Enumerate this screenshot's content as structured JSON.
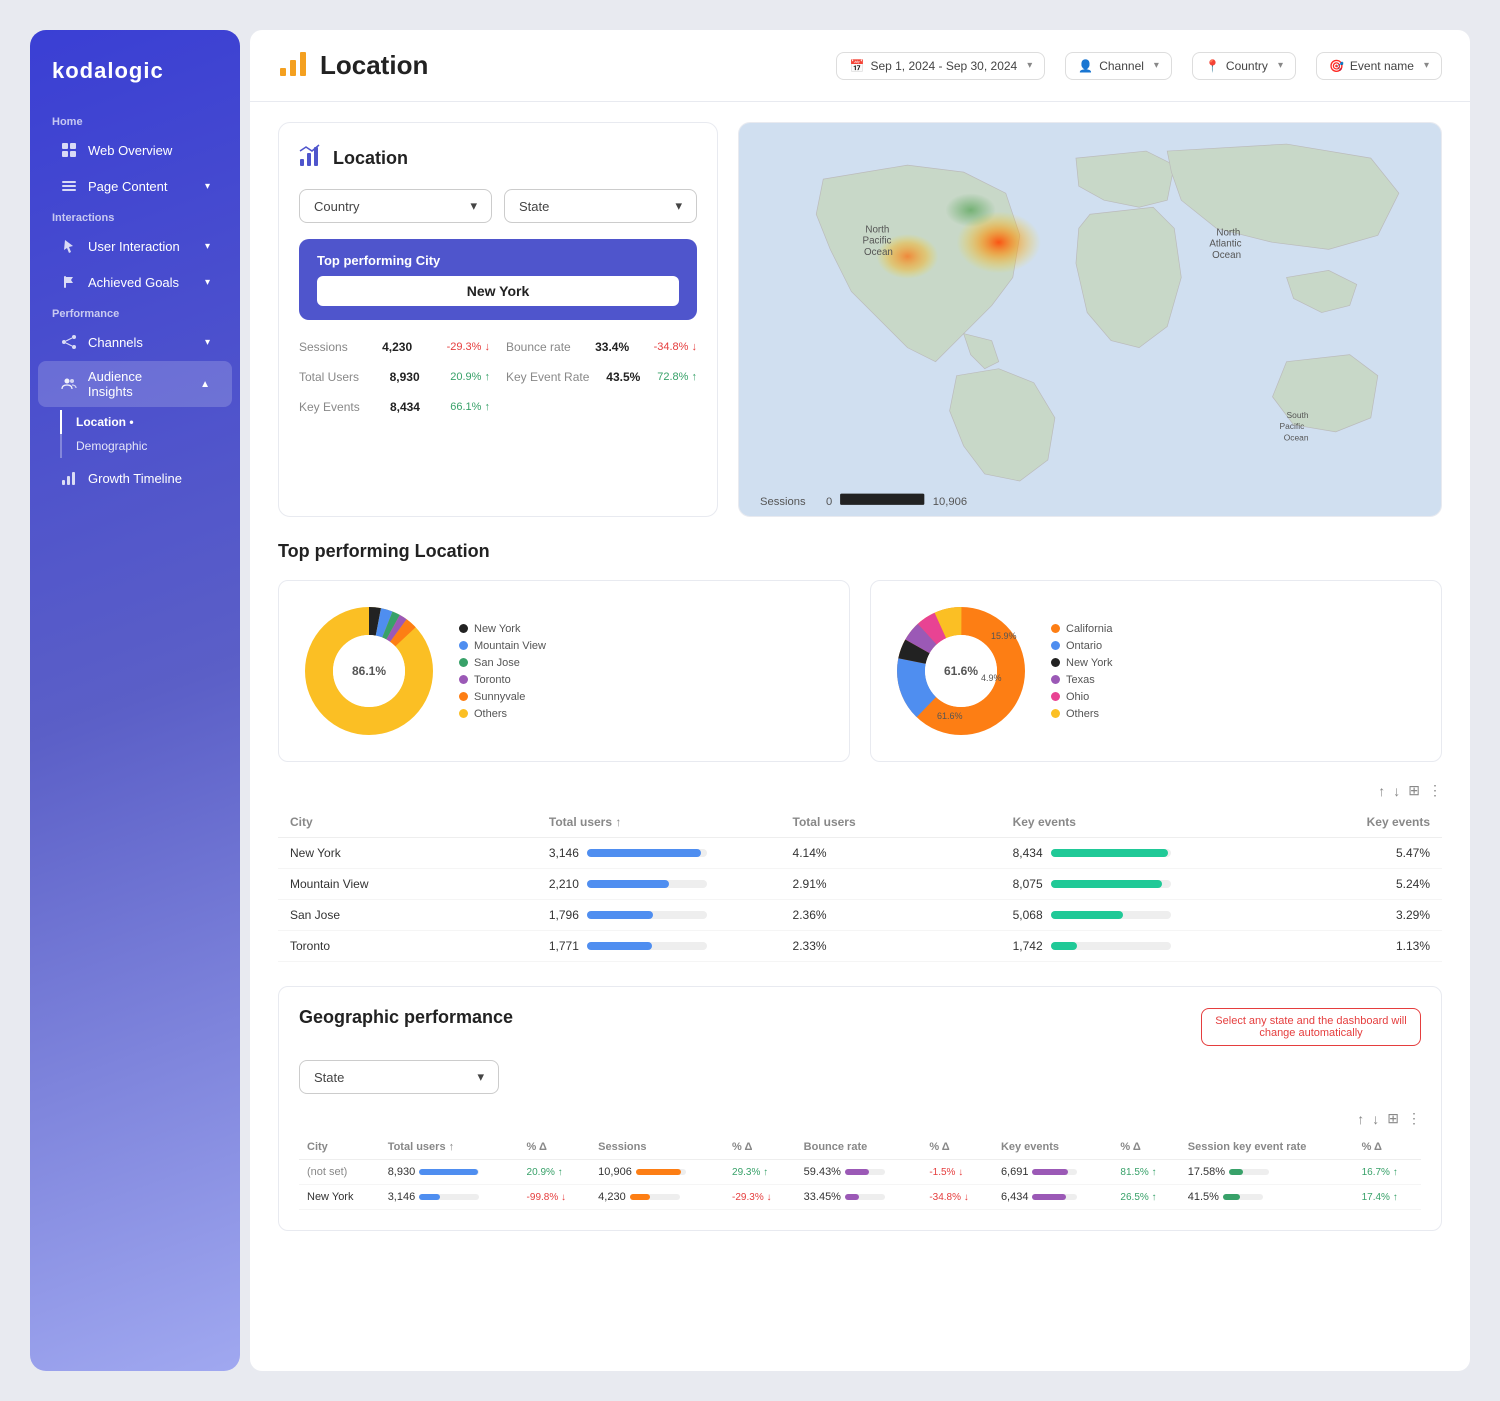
{
  "app": {
    "name": "kodalogic"
  },
  "sidebar": {
    "sections": [
      {
        "label": "Home",
        "items": [
          {
            "id": "web-overview",
            "label": "Web Overview",
            "icon": "grid",
            "active": false
          }
        ]
      },
      {
        "label": "Page Content",
        "items": [
          {
            "id": "page-content",
            "label": "Page Content",
            "icon": "list",
            "active": false,
            "hasArrow": true
          }
        ]
      },
      {
        "label": "Interactions",
        "items": [
          {
            "id": "user-interaction",
            "label": "User Interaction",
            "icon": "cursor",
            "active": false,
            "hasArrow": true
          },
          {
            "id": "achieved-goals",
            "label": "Achieved Goals",
            "icon": "flag",
            "active": false,
            "hasArrow": true
          }
        ]
      },
      {
        "label": "Performance",
        "items": [
          {
            "id": "channels",
            "label": "Channels",
            "icon": "share",
            "active": false,
            "hasArrow": true
          },
          {
            "id": "audience-insights",
            "label": "Audience Insights",
            "icon": "people",
            "active": true,
            "hasArrow": true,
            "children": [
              {
                "id": "location",
                "label": "Location •",
                "active": true
              },
              {
                "id": "demographic",
                "label": "Demographic",
                "active": false
              }
            ]
          },
          {
            "id": "growth-timeline",
            "label": "Growth Timeline",
            "icon": "chart",
            "active": false
          }
        ]
      }
    ]
  },
  "header": {
    "title": "Location",
    "filters": [
      {
        "id": "date-range",
        "icon": "📅",
        "label": "Sep 1, 2024 - Sep 30, 2024"
      },
      {
        "id": "channel",
        "icon": "👤",
        "label": "Channel"
      },
      {
        "id": "country",
        "icon": "📍",
        "label": "Country"
      },
      {
        "id": "event-name",
        "icon": "🎯",
        "label": "Event name"
      }
    ]
  },
  "location_card": {
    "title": "Location",
    "filters": [
      "Country",
      "State"
    ],
    "top_city_label": "Top performing City",
    "top_city": "New York",
    "metrics": [
      {
        "label": "Sessions",
        "value": "4,230",
        "change": "-29.3%",
        "dir": "neg"
      },
      {
        "label": "Bounce rate",
        "value": "33.4%",
        "change": "-34.8%",
        "dir": "neg"
      },
      {
        "label": "Total Users",
        "value": "8,930",
        "change": "20.9%",
        "dir": "pos"
      },
      {
        "label": "Key Event Rate",
        "value": "43.5%",
        "change": "72.8%",
        "dir": "pos"
      },
      {
        "label": "Key Events",
        "value": "8,434",
        "change": "66.1%",
        "dir": "pos"
      }
    ]
  },
  "top_performing": {
    "title": "Top performing Location",
    "city_chart": {
      "label": "86.1%",
      "segments": [
        {
          "label": "New York",
          "color": "#222",
          "pct": 3
        },
        {
          "label": "Mountain View",
          "color": "#4f8ef0",
          "pct": 3
        },
        {
          "label": "San Jose",
          "color": "#38a169",
          "pct": 2
        },
        {
          "label": "Toronto",
          "color": "#9b59b6",
          "pct": 2
        },
        {
          "label": "Sunnyvale",
          "color": "#fd7e14",
          "pct": 3
        },
        {
          "label": "Others",
          "color": "#fbbf24",
          "pct": 87
        }
      ]
    },
    "state_chart": {
      "label": "61.6%",
      "segments": [
        {
          "label": "California",
          "color": "#fd7e14",
          "pct": 62
        },
        {
          "label": "Ontario",
          "color": "#4f8ef0",
          "pct": 16
        },
        {
          "label": "New York",
          "color": "#222",
          "pct": 5
        },
        {
          "label": "Texas",
          "color": "#9b59b6",
          "pct": 5
        },
        {
          "label": "Ohio",
          "color": "#e84393",
          "pct": 5
        },
        {
          "label": "Others",
          "color": "#fbbf24",
          "pct": 7
        }
      ]
    },
    "table": {
      "headers": [
        "City",
        "Total users ↑",
        "Total users",
        "Key events",
        "Key events"
      ],
      "rows": [
        {
          "city": "New York",
          "total_users_val": "3,146",
          "total_users_bar": 95,
          "total_users_pct": "4.14%",
          "key_events": "8,434",
          "key_events_bar": 98,
          "key_events_pct": "5.47%"
        },
        {
          "city": "Mountain View",
          "total_users_val": "2,210",
          "total_users_bar": 68,
          "total_users_pct": "2.91%",
          "key_events": "8,075",
          "key_events_bar": 93,
          "key_events_pct": "5.24%"
        },
        {
          "city": "San Jose",
          "total_users_val": "1,796",
          "total_users_bar": 55,
          "total_users_pct": "2.36%",
          "key_events": "5,068",
          "key_events_bar": 60,
          "key_events_pct": "3.29%"
        },
        {
          "city": "Toronto",
          "total_users_val": "1,771",
          "total_users_bar": 54,
          "total_users_pct": "2.33%",
          "key_events": "1,742",
          "key_events_bar": 22,
          "key_events_pct": "1.13%"
        }
      ]
    }
  },
  "geographic": {
    "title": "Geographic performance",
    "filter_label": "State",
    "alert": "Select any state and the dashboard will change automatically",
    "table": {
      "headers": [
        "City",
        "Total users ↑",
        "% Δ",
        "Sessions",
        "% Δ",
        "Bounce rate",
        "% Δ",
        "Key events",
        "% Δ",
        "Session key event rate",
        "% Δ"
      ],
      "rows": [
        {
          "city": "(not set)",
          "total_users": "8,930",
          "tu_bar": 98,
          "tu_pct": "20.9% ↑",
          "sessions": "10,906",
          "s_bar_color": "orange",
          "s_pct": "29.3% ↑",
          "bounce_rate": "59.43%",
          "br_bar": 60,
          "br_pct": "-1.5% ↓",
          "key_events": "6,691",
          "ke_bar": 78,
          "ke_pct": "81.5% ↑",
          "skev_rate": "17.58%",
          "skev_bar": 35,
          "skev_pct": "16.7% ↑"
        },
        {
          "city": "New York",
          "total_users": "3,146",
          "tu_bar": 35,
          "tu_pct": "-99.8% ↓",
          "sessions": "4,230",
          "s_bar_color": "orange",
          "s_pct": "-29.3% ↓",
          "bounce_rate": "33.45%",
          "br_bar": 34,
          "br_pct": "-34.8% ↓",
          "key_events": "6,434",
          "ke_bar": 75,
          "ke_pct": "26.5% ↑",
          "skev_rate": "41.5%",
          "skev_bar": 42,
          "skev_pct": "17.4% ↑"
        }
      ]
    }
  },
  "map": {
    "sessions_min": "0",
    "sessions_max": "10,906"
  }
}
